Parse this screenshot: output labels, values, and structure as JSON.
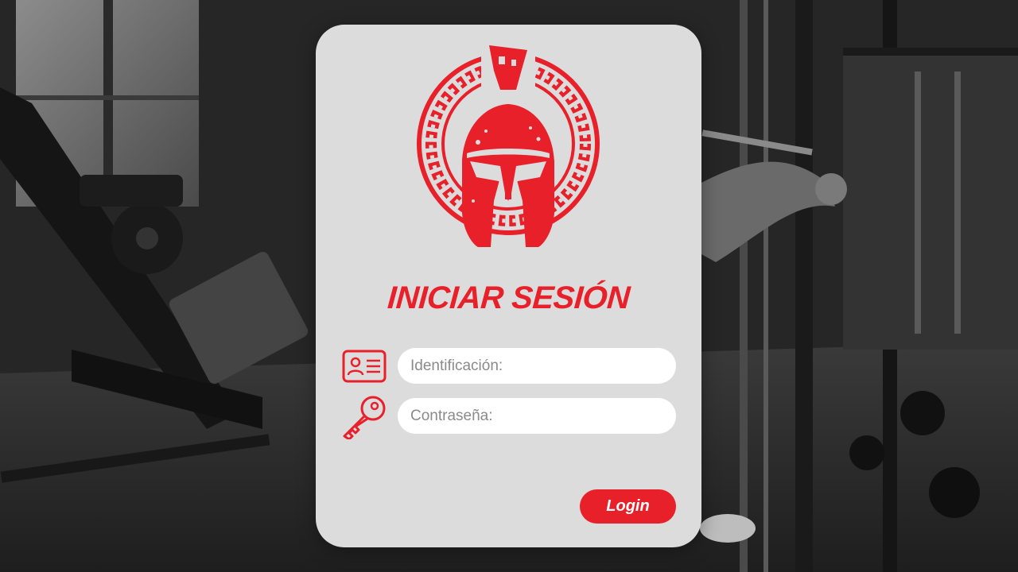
{
  "login": {
    "title": "INICIAR SESIÓN",
    "id_field": {
      "placeholder": "Identificación:",
      "value": ""
    },
    "password_field": {
      "placeholder": "Contraseña:",
      "value": ""
    },
    "login_button_label": "Login"
  },
  "icons": {
    "logo": "spartan-helmet-logo",
    "id": "id-card-icon",
    "password": "key-icon"
  },
  "colors": {
    "accent": "#e8202a",
    "card_background": "#dcdcdc",
    "input_background": "#ffffff",
    "placeholder_text": "#8a8a8a"
  }
}
